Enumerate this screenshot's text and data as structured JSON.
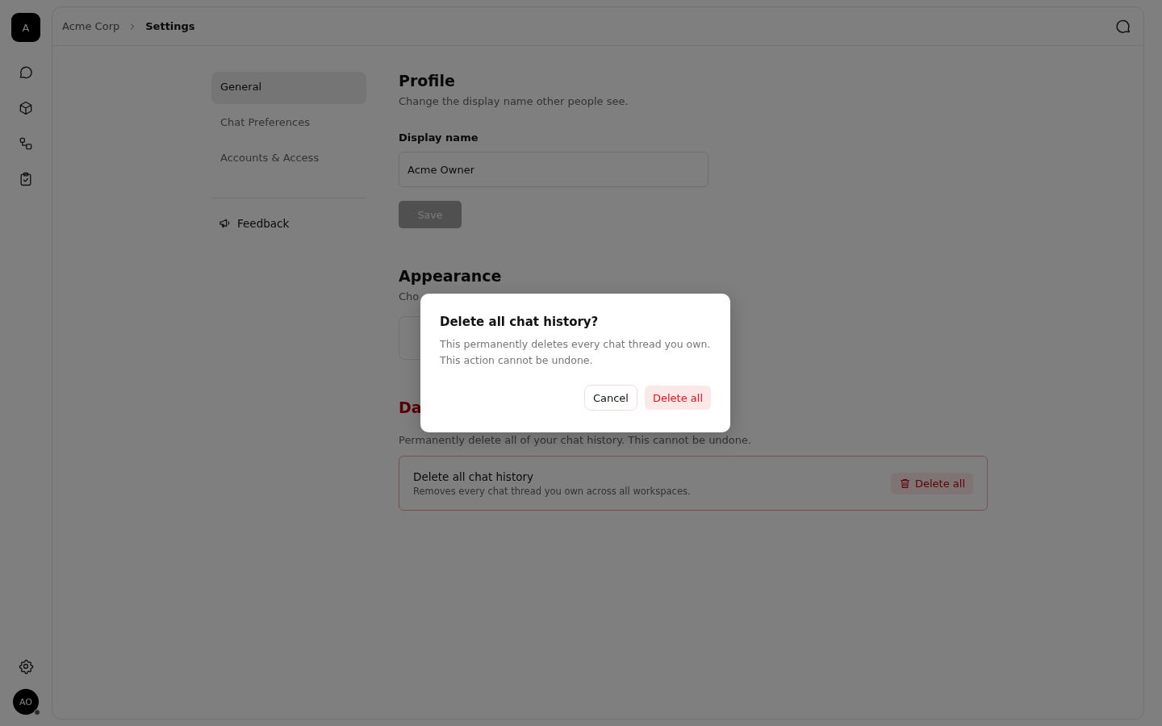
{
  "workspace": {
    "initial": "A"
  },
  "rail": {
    "user": {
      "initials": "AO",
      "online": false
    }
  },
  "breadcrumb": [
    "Acme Corp",
    "Settings"
  ],
  "settings_nav": {
    "items": [
      {
        "label": "General",
        "selected": true
      },
      {
        "label": "Chat Preferences",
        "selected": false
      },
      {
        "label": "Accounts & Access",
        "selected": false
      }
    ],
    "feedback": "Feedback"
  },
  "profile": {
    "title": "Profile",
    "description": "Change the display name other people see.",
    "field_label": "Display name",
    "value": "Acme Owner",
    "save": "Save",
    "save_disabled": true
  },
  "appearance": {
    "title": "Appearance",
    "description": "Cho"
  },
  "danger": {
    "title": "Da",
    "description": "Permanently delete all of your chat history. This cannot be undone.",
    "item_title": "Delete all chat history",
    "item_description": "Removes every chat thread you own across all workspaces.",
    "button": "Delete all"
  },
  "dialog": {
    "title": "Delete all chat history?",
    "lines": [
      "This permanently deletes every chat thread you own.",
      "This action cannot be undone."
    ],
    "cancel": "Cancel",
    "confirm": "Delete all"
  }
}
